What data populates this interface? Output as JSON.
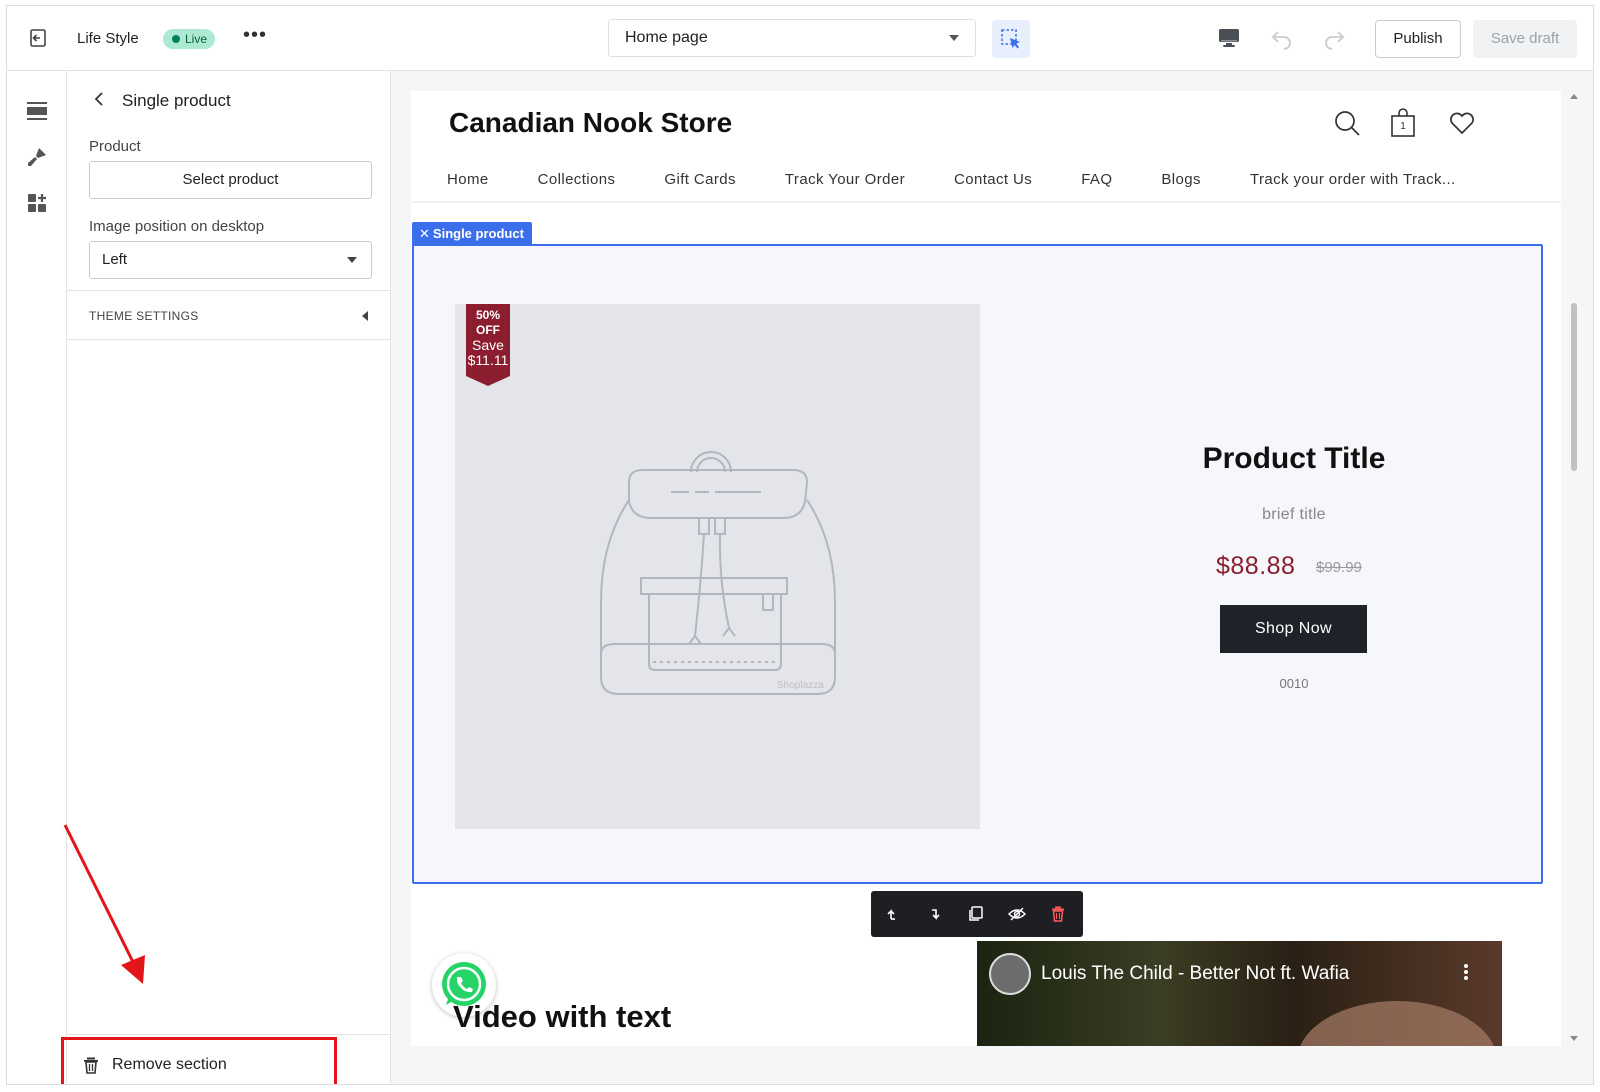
{
  "topbar": {
    "store_title": "Life Style",
    "live_badge": "Live",
    "more_label": "•••",
    "page_select": "Home page",
    "publish_label": "Publish",
    "save_draft_label": "Save draft"
  },
  "panel": {
    "title": "Single product",
    "product_label": "Product",
    "select_product_label": "Select product",
    "image_position_label": "Image position on desktop",
    "image_position_value": "Left",
    "theme_settings_label": "THEME SETTINGS",
    "remove_section_label": "Remove section"
  },
  "preview": {
    "store_name": "Canadian Nook Store",
    "cart_count": "1",
    "nav": [
      "Home",
      "Collections",
      "Gift Cards",
      "Track Your Order",
      "Contact Us",
      "FAQ",
      "Blogs",
      "Track your order with Track..."
    ],
    "selected_section_tag": "Single product",
    "badge": {
      "percent": "50%",
      "off": "OFF",
      "save": "Save",
      "amount": "$11.11"
    },
    "watermark": "Shoplazza",
    "product_title": "Product Title",
    "brief_title": "brief title",
    "price": "$88.88",
    "compare_price": "$99.99",
    "shop_now_label": "Shop Now",
    "sku": "0010",
    "video_with_text_title": "Video with text",
    "video_title": "Louis The Child - Better Not ft. Wafia"
  },
  "colors": {
    "accent": "#3b6eea",
    "price": "#8c1d2f",
    "badge": "#8c1d2f",
    "highlight": "#e2151b",
    "live": "#aee9d1"
  },
  "icons": [
    "exit-icon",
    "inspect-icon",
    "desktop-icon",
    "undo-icon",
    "redo-icon",
    "sections-icon",
    "theme-brush-icon",
    "apps-icon",
    "back-chevron-icon",
    "trash-icon",
    "search-icon",
    "cart-icon",
    "heart-icon",
    "move-up-icon",
    "move-down-icon",
    "duplicate-icon",
    "hide-icon",
    "delete-icon",
    "whatsapp-icon"
  ]
}
